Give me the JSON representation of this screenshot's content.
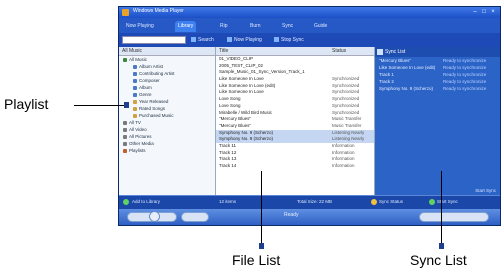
{
  "callouts": {
    "playlist": "Playlist",
    "file_list": "File List",
    "sync_list": "Sync List"
  },
  "window": {
    "title": "Windows Media Player",
    "tabs": [
      "Now Playing",
      "Library",
      "Rip",
      "Burn",
      "Sync",
      "Guide"
    ],
    "active_tab_index": 1
  },
  "toolbar": {
    "search_label": "Search",
    "now_playing_label": "Now Playing",
    "stop_sync_label": "Stop Sync"
  },
  "playlist_pane": {
    "header": "All Music",
    "items": [
      {
        "label": "All Music",
        "icon_color": "#3a8a3a"
      },
      {
        "label": "Album Artist",
        "icon_color": "#4a79c8"
      },
      {
        "label": "Contributing Artist",
        "icon_color": "#4a79c8"
      },
      {
        "label": "Composer",
        "icon_color": "#4a79c8"
      },
      {
        "label": "Album",
        "icon_color": "#4a79c8"
      },
      {
        "label": "Genre",
        "icon_color": "#4a79c8"
      },
      {
        "label": "Year Released",
        "icon_color": "#d2a040"
      },
      {
        "label": "Rated Songs",
        "icon_color": "#d2a040"
      },
      {
        "label": "Purchased Music",
        "icon_color": "#d2a040"
      },
      {
        "label": "All TV",
        "icon_color": "#7a7a7a"
      },
      {
        "label": "All Video",
        "icon_color": "#7a7a7a"
      },
      {
        "label": "All Pictures",
        "icon_color": "#7a7a7a"
      },
      {
        "label": "Other Media",
        "icon_color": "#7a7a7a"
      },
      {
        "label": "Playlists",
        "icon_color": "#c0602a"
      }
    ]
  },
  "file_pane": {
    "col_title": "Title",
    "col_status": "Status",
    "rows": [
      {
        "title": "01_VIDEO_CLIP",
        "status": ""
      },
      {
        "title": "2005_TEST_CLIP_02",
        "status": ""
      },
      {
        "title": "Sample_Music_01_Sync_Version_Track_1",
        "status": ""
      },
      {
        "title": "Like Someone In Love",
        "status": "Synchronized"
      },
      {
        "title": "Like Someone In Love (edit)",
        "status": "Synchronized"
      },
      {
        "title": "Like Someone In Love",
        "status": "Synchronized"
      },
      {
        "title": "Love Song",
        "status": "Synchronized"
      },
      {
        "title": "Love Song",
        "status": "Synchronized"
      },
      {
        "title": "Mirabelle / Wild Bird Music",
        "status": "Synchronized"
      },
      {
        "title": "\"Mercury Blues\"",
        "status": "Music Transfer"
      },
      {
        "title": "\"Mercury Blues\"",
        "status": "Music Transfer"
      },
      {
        "title": "Symphony No. 9 (Scherzo)",
        "status": "Listening Nearly"
      },
      {
        "title": "Symphony No. 9 (Scherzo)",
        "status": "Listening Nearly"
      },
      {
        "title": "Track 11",
        "status": "Information"
      },
      {
        "title": "Track 12",
        "status": "Information"
      },
      {
        "title": "Track 13",
        "status": "Information"
      },
      {
        "title": "Track 14",
        "status": "Information"
      }
    ],
    "selected_indices": [
      11,
      12
    ]
  },
  "sync_pane": {
    "header": "Sync List",
    "rows": [
      {
        "title": "\"Mercury Blues\"",
        "right": "Ready to synchronize"
      },
      {
        "title": "Like Someone In Love (edit)",
        "right": "Ready to synchronize"
      },
      {
        "title": "Track 1",
        "right": "Ready to synchronize"
      },
      {
        "title": "Track 2",
        "right": "Ready to synchronize"
      },
      {
        "title": "Symphony No. 9 (Scherzo)",
        "right": "Ready to synchronize"
      }
    ],
    "footer": "Start Sync"
  },
  "status_bar": {
    "left": "Add to Library",
    "middle": "12 items",
    "right_1": "Total Size: 22 MB",
    "right_2": "Sync Status",
    "right_3": "Start Sync"
  },
  "player": {
    "now_playing": "Ready"
  }
}
